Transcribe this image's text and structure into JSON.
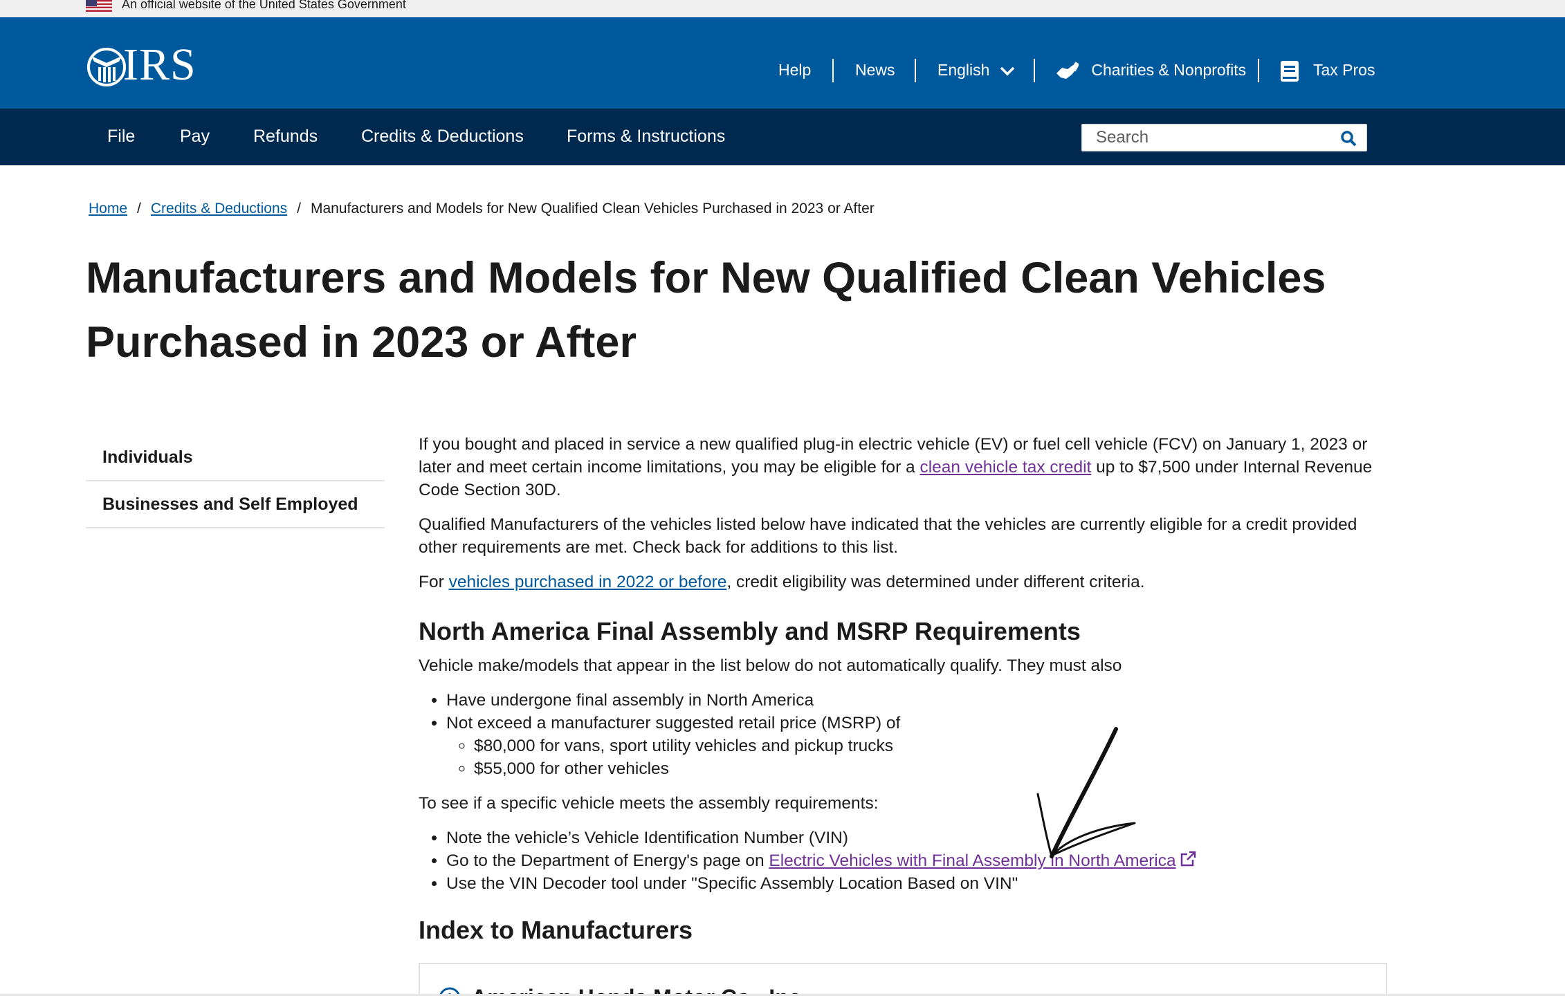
{
  "gov_banner": {
    "text": "An official website of the United States Government"
  },
  "header": {
    "logo_text": "IRS",
    "utility_nav": [
      {
        "label": "Help"
      },
      {
        "label": "News"
      },
      {
        "label": "English"
      },
      {
        "label": "Charities & Nonprofits"
      },
      {
        "label": "Tax Pros"
      }
    ]
  },
  "main_nav": {
    "items": [
      {
        "label": "File"
      },
      {
        "label": "Pay"
      },
      {
        "label": "Refunds"
      },
      {
        "label": "Credits & Deductions"
      },
      {
        "label": "Forms & Instructions"
      }
    ],
    "search_placeholder": "Search"
  },
  "breadcrumb": {
    "home": "Home",
    "credits": "Credits & Deductions",
    "current": "Manufacturers and Models for New Qualified Clean Vehicles Purchased in 2023 or After"
  },
  "page_title": "Manufacturers and Models for New Qualified Clean Vehicles Purchased in 2023 or After",
  "side_nav": [
    {
      "label": "Individuals"
    },
    {
      "label": "Businesses and Self Employed"
    }
  ],
  "content": {
    "p1_a": "If you bought and placed in service a new qualified plug-in electric vehicle (EV) or fuel cell vehicle (FCV) on January 1, 2023 or later and meet certain income limitations, you may be eligible for a ",
    "p1_link": "clean vehicle tax credit",
    "p1_b": " up to $7,500 under Internal Revenue Code Section 30D.",
    "p2": "Qualified Manufacturers of the vehicles listed below have indicated that the vehicles are currently eligible for a credit provided other requirements are met.  Check back for additions to this list.",
    "p3_a": "For ",
    "p3_link": "vehicles purchased in 2022 or before",
    "p3_b": ", credit eligibility was determined under different criteria.",
    "h2_assembly": "North America Final Assembly and MSRP Requirements",
    "p4": "Vehicle make/models that appear in the list below do not automatically qualify. They must also",
    "req_list": [
      "Have undergone final assembly in North America",
      "Not exceed a manufacturer suggested retail price (MSRP) of"
    ],
    "msrp_list": [
      "$80,000 for vans, sport utility vehicles and pickup trucks",
      "$55,000 for other vehicles"
    ],
    "p5": "To see if a specific vehicle meets the assembly requirements:",
    "steps": {
      "s1": "Note the vehicle’s Vehicle Identification Number (VIN)",
      "s2_a": "Go to the Department of Energy's page on ",
      "s2_link": "Electric Vehicles with Final Assembly in North America",
      "s3": "Use the VIN Decoder tool under \"Specific Assembly Location Based on VIN\""
    },
    "h2_index": "Index to Manufacturers"
  },
  "accordion": {
    "first_label": "American Honda Motor Co., Inc."
  },
  "colors": {
    "header_blue": "#00599c",
    "nav_dark": "#00294f",
    "link_blue": "#00599c",
    "visited_purple": "#6f3196"
  }
}
